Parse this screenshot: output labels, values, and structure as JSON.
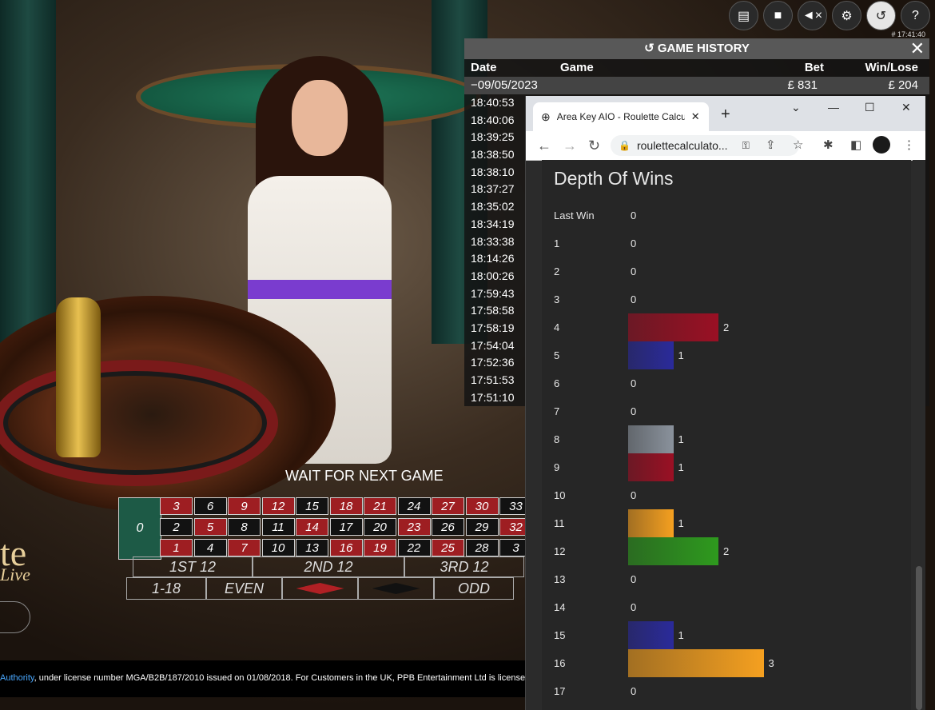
{
  "game": {
    "status_text": "WAIT FOR NEXT GAME",
    "brand_line1": "te",
    "brand_line2": "Live",
    "board": {
      "zero": "0",
      "rows": [
        [
          {
            "n": "3",
            "c": "r"
          },
          {
            "n": "6",
            "c": "b"
          },
          {
            "n": "9",
            "c": "r"
          },
          {
            "n": "12",
            "c": "r"
          },
          {
            "n": "15",
            "c": "b"
          },
          {
            "n": "18",
            "c": "r"
          },
          {
            "n": "21",
            "c": "r"
          },
          {
            "n": "24",
            "c": "b"
          },
          {
            "n": "27",
            "c": "r"
          },
          {
            "n": "30",
            "c": "r"
          },
          {
            "n": "33",
            "c": "b"
          }
        ],
        [
          {
            "n": "2",
            "c": "b"
          },
          {
            "n": "5",
            "c": "r"
          },
          {
            "n": "8",
            "c": "b"
          },
          {
            "n": "11",
            "c": "b"
          },
          {
            "n": "14",
            "c": "r"
          },
          {
            "n": "17",
            "c": "b"
          },
          {
            "n": "20",
            "c": "b"
          },
          {
            "n": "23",
            "c": "r"
          },
          {
            "n": "26",
            "c": "b"
          },
          {
            "n": "29",
            "c": "b"
          },
          {
            "n": "32",
            "c": "r"
          }
        ],
        [
          {
            "n": "1",
            "c": "r"
          },
          {
            "n": "4",
            "c": "b"
          },
          {
            "n": "7",
            "c": "r"
          },
          {
            "n": "10",
            "c": "b"
          },
          {
            "n": "13",
            "c": "b"
          },
          {
            "n": "16",
            "c": "r"
          },
          {
            "n": "19",
            "c": "r"
          },
          {
            "n": "22",
            "c": "b"
          },
          {
            "n": "25",
            "c": "r"
          },
          {
            "n": "28",
            "c": "b"
          },
          {
            "n": "3",
            "c": "b"
          }
        ]
      ],
      "dozens": [
        "1ST 12",
        "2ND 12",
        "3RD 12"
      ],
      "outside": [
        "1-18",
        "EVEN",
        "",
        "",
        "ODD"
      ]
    },
    "footer_link": "Authority",
    "footer_text": ", under license number MGA/B2B/187/2010 issued on 01/08/2018. For Customers in the UK, PPB Entertainment Ltd is licensed"
  },
  "top_icons": [
    "chat-icon",
    "video-icon",
    "mute-icon",
    "settings-icon",
    "history-icon",
    "help-icon"
  ],
  "round_id": "# 17:41:40",
  "history": {
    "title": "GAME HISTORY",
    "col_date": "Date",
    "col_game": "Game",
    "col_bet": "Bet",
    "col_winlose": "Win/Lose",
    "date_row": {
      "date": "09/05/2023",
      "bet": "£ 831",
      "win": "£ 204"
    },
    "times": [
      "18:40:53",
      "18:40:06",
      "18:39:25",
      "18:38:50",
      "18:38:10",
      "18:37:27",
      "18:35:02",
      "18:34:19",
      "18:33:38",
      "18:14:26",
      "18:00:26",
      "17:59:43",
      "17:58:58",
      "17:58:19",
      "17:54:04",
      "17:52:36",
      "17:51:53",
      "17:51:10"
    ]
  },
  "browser": {
    "tab_title": "Area Key AIO - Roulette Calcu",
    "url": "roulettecalculato...",
    "page_title": "Depth Of Wins",
    "rows": [
      {
        "label": "Last Win",
        "value": 0
      },
      {
        "label": "1",
        "value": 0
      },
      {
        "label": "2",
        "value": 0
      },
      {
        "label": "3",
        "value": 0
      },
      {
        "label": "4",
        "value": 2,
        "color": "#9a1024"
      },
      {
        "label": "5",
        "value": 1,
        "color": "#2a2a9a"
      },
      {
        "label": "6",
        "value": 0
      },
      {
        "label": "7",
        "value": 0
      },
      {
        "label": "8",
        "value": 1,
        "color": "#8a929c"
      },
      {
        "label": "9",
        "value": 1,
        "color": "#9a1024"
      },
      {
        "label": "10",
        "value": 0
      },
      {
        "label": "11",
        "value": 1,
        "color": "#f5a020"
      },
      {
        "label": "12",
        "value": 2,
        "color": "#2e9a1e"
      },
      {
        "label": "13",
        "value": 0
      },
      {
        "label": "14",
        "value": 0
      },
      {
        "label": "15",
        "value": 1,
        "color": "#2a2a9a"
      },
      {
        "label": "16",
        "value": 3,
        "color": "#f5a020"
      },
      {
        "label": "17",
        "value": 0
      }
    ]
  }
}
